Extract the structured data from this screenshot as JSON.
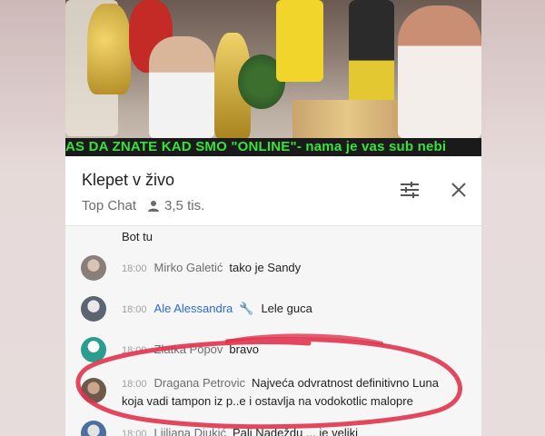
{
  "video": {
    "ticker": "AS DA ZNATE KAD SMO \"ONLINE\"- nama je vas sub nebi"
  },
  "chat": {
    "title": "Klepet v živo",
    "mode": "Top Chat",
    "viewers": "3,5 tis."
  },
  "messages": [
    {
      "ts": "",
      "author": "",
      "text": "Bot tu",
      "avatar": ""
    },
    {
      "ts": "18:00",
      "author": "Mirko Galetić",
      "text": "tako je Sandy",
      "avatar": "#8a7f78"
    },
    {
      "ts": "18:00",
      "author": "Ale Alessandra",
      "text": "Lele guca",
      "avatar": "#5b6470",
      "moderator": true
    },
    {
      "ts": "18:00",
      "author": "Zlatka Popov",
      "text": "bravo",
      "avatar": "#2a9d8f"
    },
    {
      "ts": "18:00",
      "author": "Dragana Petrovic",
      "text": "Najveća odvratnost definitivno Luna",
      "text2": "koja vadi tampon iz p..e i ostavlja na vodokotlic malopre",
      "avatar": "#6e5a4a"
    },
    {
      "ts": "18:00",
      "author": "Ljiljana Djukić",
      "text": "Pali Nadeždu ... je veliki",
      "avatar": "#4b6fa0"
    }
  ],
  "colors": {
    "ticker_text": "#37e23b",
    "moderator": "#2a6bd8",
    "annotation_circle": "#e0344e"
  },
  "icons": [
    "person-icon",
    "tune-icon",
    "close-icon",
    "wrench-icon",
    "chevron-down-icon"
  ]
}
